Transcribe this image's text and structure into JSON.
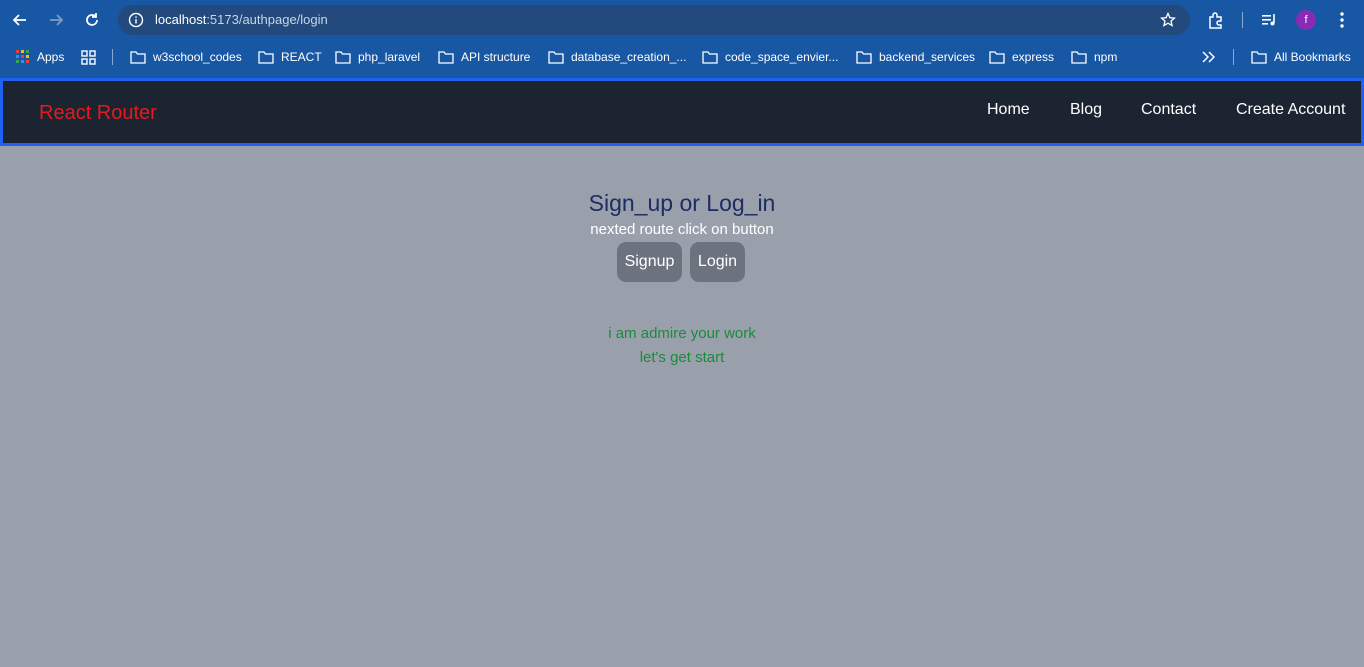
{
  "browser": {
    "url_host": "localhost",
    "url_path": ":5173/authpage/login",
    "profile_initial": "f",
    "bookmarks": [
      "Apps",
      "w3school_codes",
      "REACT",
      "php_laravel",
      "API structure",
      "database_creation_...",
      "code_space_envier...",
      "backend_services",
      "express",
      "npm"
    ],
    "all_bookmarks_label": "All Bookmarks"
  },
  "app": {
    "brand": "React Router",
    "nav": [
      "Home",
      "Blog",
      "Contact",
      "Create Account"
    ],
    "heading": "Sign_up or Log_in",
    "subheading": "nexted route click on button",
    "buttons": {
      "signup": "Signup",
      "login": "Login"
    },
    "message_line1": "i am admire your work",
    "message_line2": "let's get start"
  },
  "colors": {
    "browser_bar": "#1857a4",
    "navbar": "#1b2430",
    "navbar_border": "#1f62f0",
    "brand": "#e8191c",
    "page_bg": "#9aa0ab",
    "heading": "#1d2d63",
    "message": "#1a8a3b"
  }
}
